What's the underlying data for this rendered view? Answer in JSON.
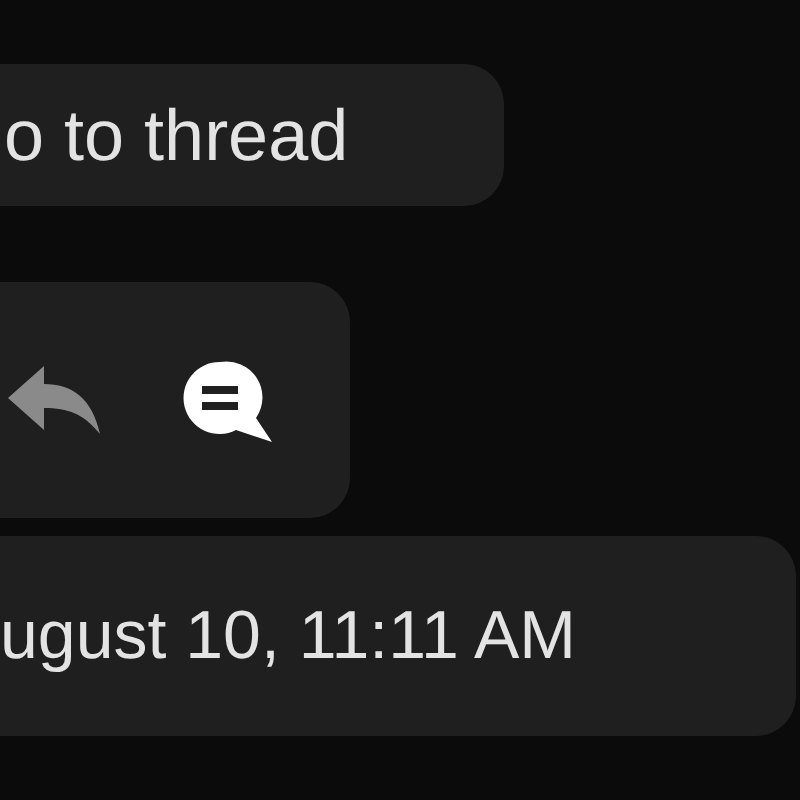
{
  "thread_tooltip": {
    "label": "o to thread"
  },
  "message_actions": [
    {
      "kind": "reply",
      "selected": false
    },
    {
      "kind": "thread",
      "selected": true
    }
  ],
  "timestamp_tooltip": {
    "label": "ugust 10, 11:11 AM"
  }
}
